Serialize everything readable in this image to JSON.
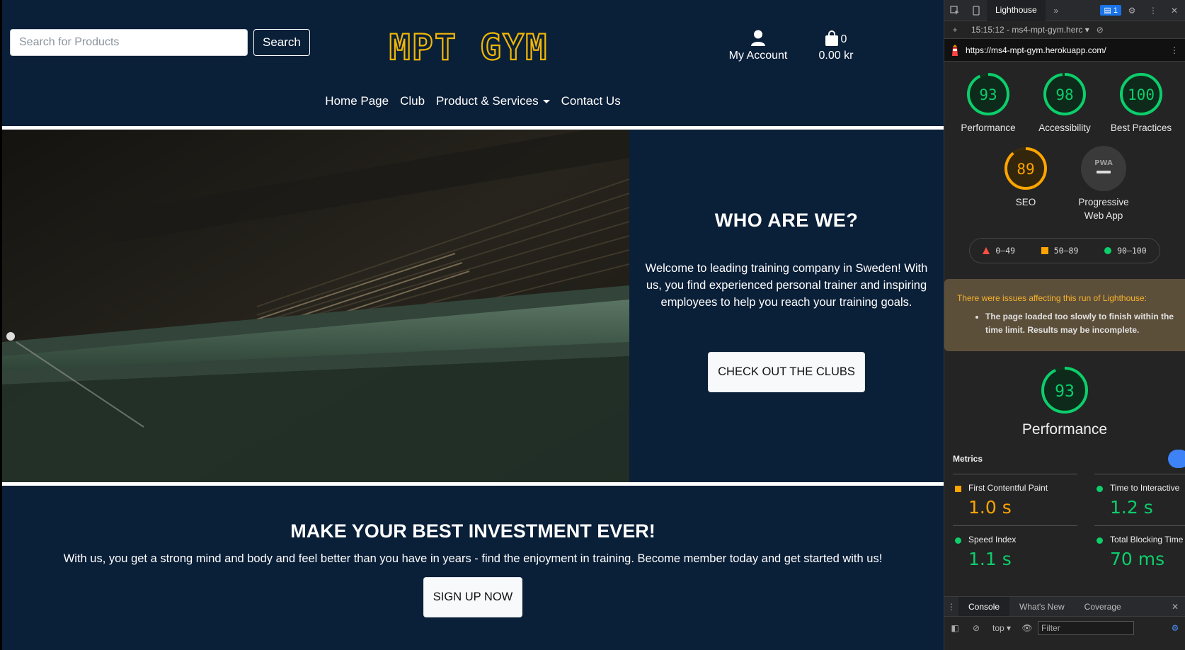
{
  "site": {
    "search": {
      "placeholder": "Search for Products",
      "button_label": "Search"
    },
    "logo_text": "MPT GYM",
    "account_label": "My Account",
    "bag": {
      "count": "0",
      "total": "0.00 kr"
    },
    "nav": [
      {
        "label": "Home Page"
      },
      {
        "label": "Club"
      },
      {
        "label": "Product & Services"
      },
      {
        "label": "Contact Us"
      }
    ],
    "hero": {
      "title": "WHO ARE WE?",
      "description": "Welcome to leading training company in Sweden! With us, you find experienced personal trainer and inspiring employees to help you reach your training goals.",
      "button_label": "CHECK OUT THE CLUBS"
    },
    "invest": {
      "title": "MAKE YOUR BEST INVESTMENT EVER!",
      "description": "With us, you get a strong mind and body and feel better than you have in years - find the enjoyment in training. Become member today and get started with us!",
      "button_label": "SIGN UP NOW"
    },
    "colors": {
      "background": "#0a1f38",
      "logo": "#f2b705"
    }
  },
  "devtools": {
    "active_tab": "Lighthouse",
    "badge_count": "1",
    "report_label": "15:15:12 - ms4-mpt-gym.herc",
    "url": "https://ms4-mpt-gym.herokuapp.com/",
    "scores": [
      {
        "label": "Performance",
        "value": 93,
        "color": "#0cce6b"
      },
      {
        "label": "Accessibility",
        "value": 98,
        "color": "#0cce6b"
      },
      {
        "label": "Best Practices",
        "value": 100,
        "color": "#0cce6b"
      },
      {
        "label": "SEO",
        "value": 89,
        "color": "#ffa400"
      }
    ],
    "pwa_label": "Progressive Web App",
    "pwa_badge": "PWA",
    "legend": [
      {
        "range": "0–49",
        "color": "#ff4e42",
        "shape": "triangle"
      },
      {
        "range": "50–89",
        "color": "#ffa400",
        "shape": "square"
      },
      {
        "range": "90–100",
        "color": "#0cce6b",
        "shape": "circle"
      }
    ],
    "warning": {
      "title": "There were issues affecting this run of Lighthouse:",
      "item": "The page loaded too slowly to finish within the time limit. Results may be incomplete."
    },
    "performance": {
      "score": "93",
      "label": "Performance"
    },
    "metrics_title": "Metrics",
    "metrics": [
      {
        "name": "First Contentful Paint",
        "value": "1.0 s",
        "color": "#ffa400",
        "shape": "square"
      },
      {
        "name": "Time to Interactive",
        "value": "1.2 s",
        "color": "#0cce6b",
        "shape": "circle"
      },
      {
        "name": "Speed Index",
        "value": "1.1 s",
        "color": "#0cce6b",
        "shape": "circle"
      },
      {
        "name": "Total Blocking Time",
        "value": "70 ms",
        "color": "#0cce6b",
        "shape": "circle"
      }
    ],
    "drawer_tabs": [
      "Console",
      "What's New",
      "Coverage"
    ],
    "console_context": "top",
    "filter_placeholder": "Filter"
  }
}
